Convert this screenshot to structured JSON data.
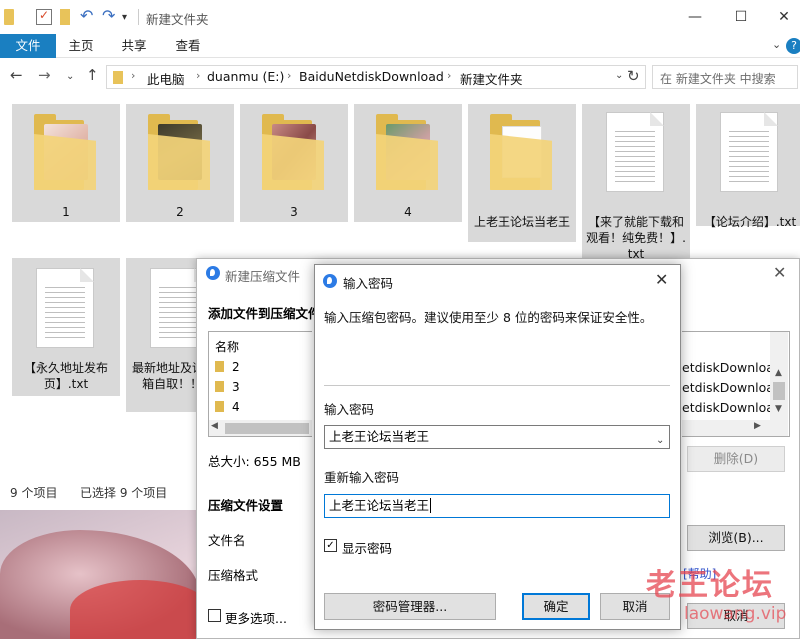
{
  "explorer": {
    "title": "新建文件夹",
    "ribbon_tabs": [
      "文件",
      "主页",
      "共享",
      "查看"
    ],
    "breadcrumbs": [
      "此电脑",
      "duanmu (E:)",
      "BaiduNetdiskDownload",
      "新建文件夹"
    ],
    "search_placeholder": "在 新建文件夹 中搜索",
    "items": [
      {
        "label": "1",
        "type": "folder"
      },
      {
        "label": "2",
        "type": "folder"
      },
      {
        "label": "3",
        "type": "folder"
      },
      {
        "label": "4",
        "type": "folder"
      },
      {
        "label": "上老王论坛当老王",
        "type": "folder"
      },
      {
        "label": "【来了就能下载和观看！纯免费！】.txt",
        "type": "txt"
      },
      {
        "label": "【论坛介绍】.txt",
        "type": "txt"
      },
      {
        "label": "【永久地址发布页】.txt",
        "type": "txt"
      },
      {
        "label": "最新地址及请发邮箱自取！！！.",
        "type": "txt"
      }
    ],
    "status": {
      "count": "9 个项目",
      "selected": "已选择 9 个项目"
    }
  },
  "compress_dialog": {
    "title": "新建压缩文件",
    "add_files_label": "添加文件到压缩文件",
    "list_header": "名称",
    "list_rows": [
      "2",
      "3",
      "4"
    ],
    "path_rows": [
      "etdiskDownloa",
      "etdiskDownloa",
      "etdiskDownloa"
    ],
    "total_size": "总大小: 655 MB",
    "delete_button": "删除(D)",
    "settings_heading": "压缩文件设置",
    "filename_label": "文件名",
    "format_label": "压缩格式",
    "browse_button": "浏览(B)...",
    "help_link": "[帮助]",
    "more_options": "更多选项...",
    "cancel_button": "取消"
  },
  "password_dialog": {
    "title": "输入密码",
    "description": "输入压缩包密码。建议使用至少 8 位的密码来保证安全性。",
    "password_label": "输入密码",
    "password_value": "上老王论坛当老王",
    "confirm_label": "重新输入密码",
    "confirm_value": "上老王论坛当老王",
    "show_password_label": "显示密码",
    "show_password_checked": true,
    "manager_button": "密码管理器...",
    "ok_button": "确定",
    "cancel_button": "取消"
  },
  "watermark": {
    "line1": "老王论坛",
    "line2": "laowang.vip"
  },
  "colors": {
    "ribbon_file_tab": "#1a7fc1",
    "focus_border": "#0078d7",
    "watermark": "#e64650"
  }
}
